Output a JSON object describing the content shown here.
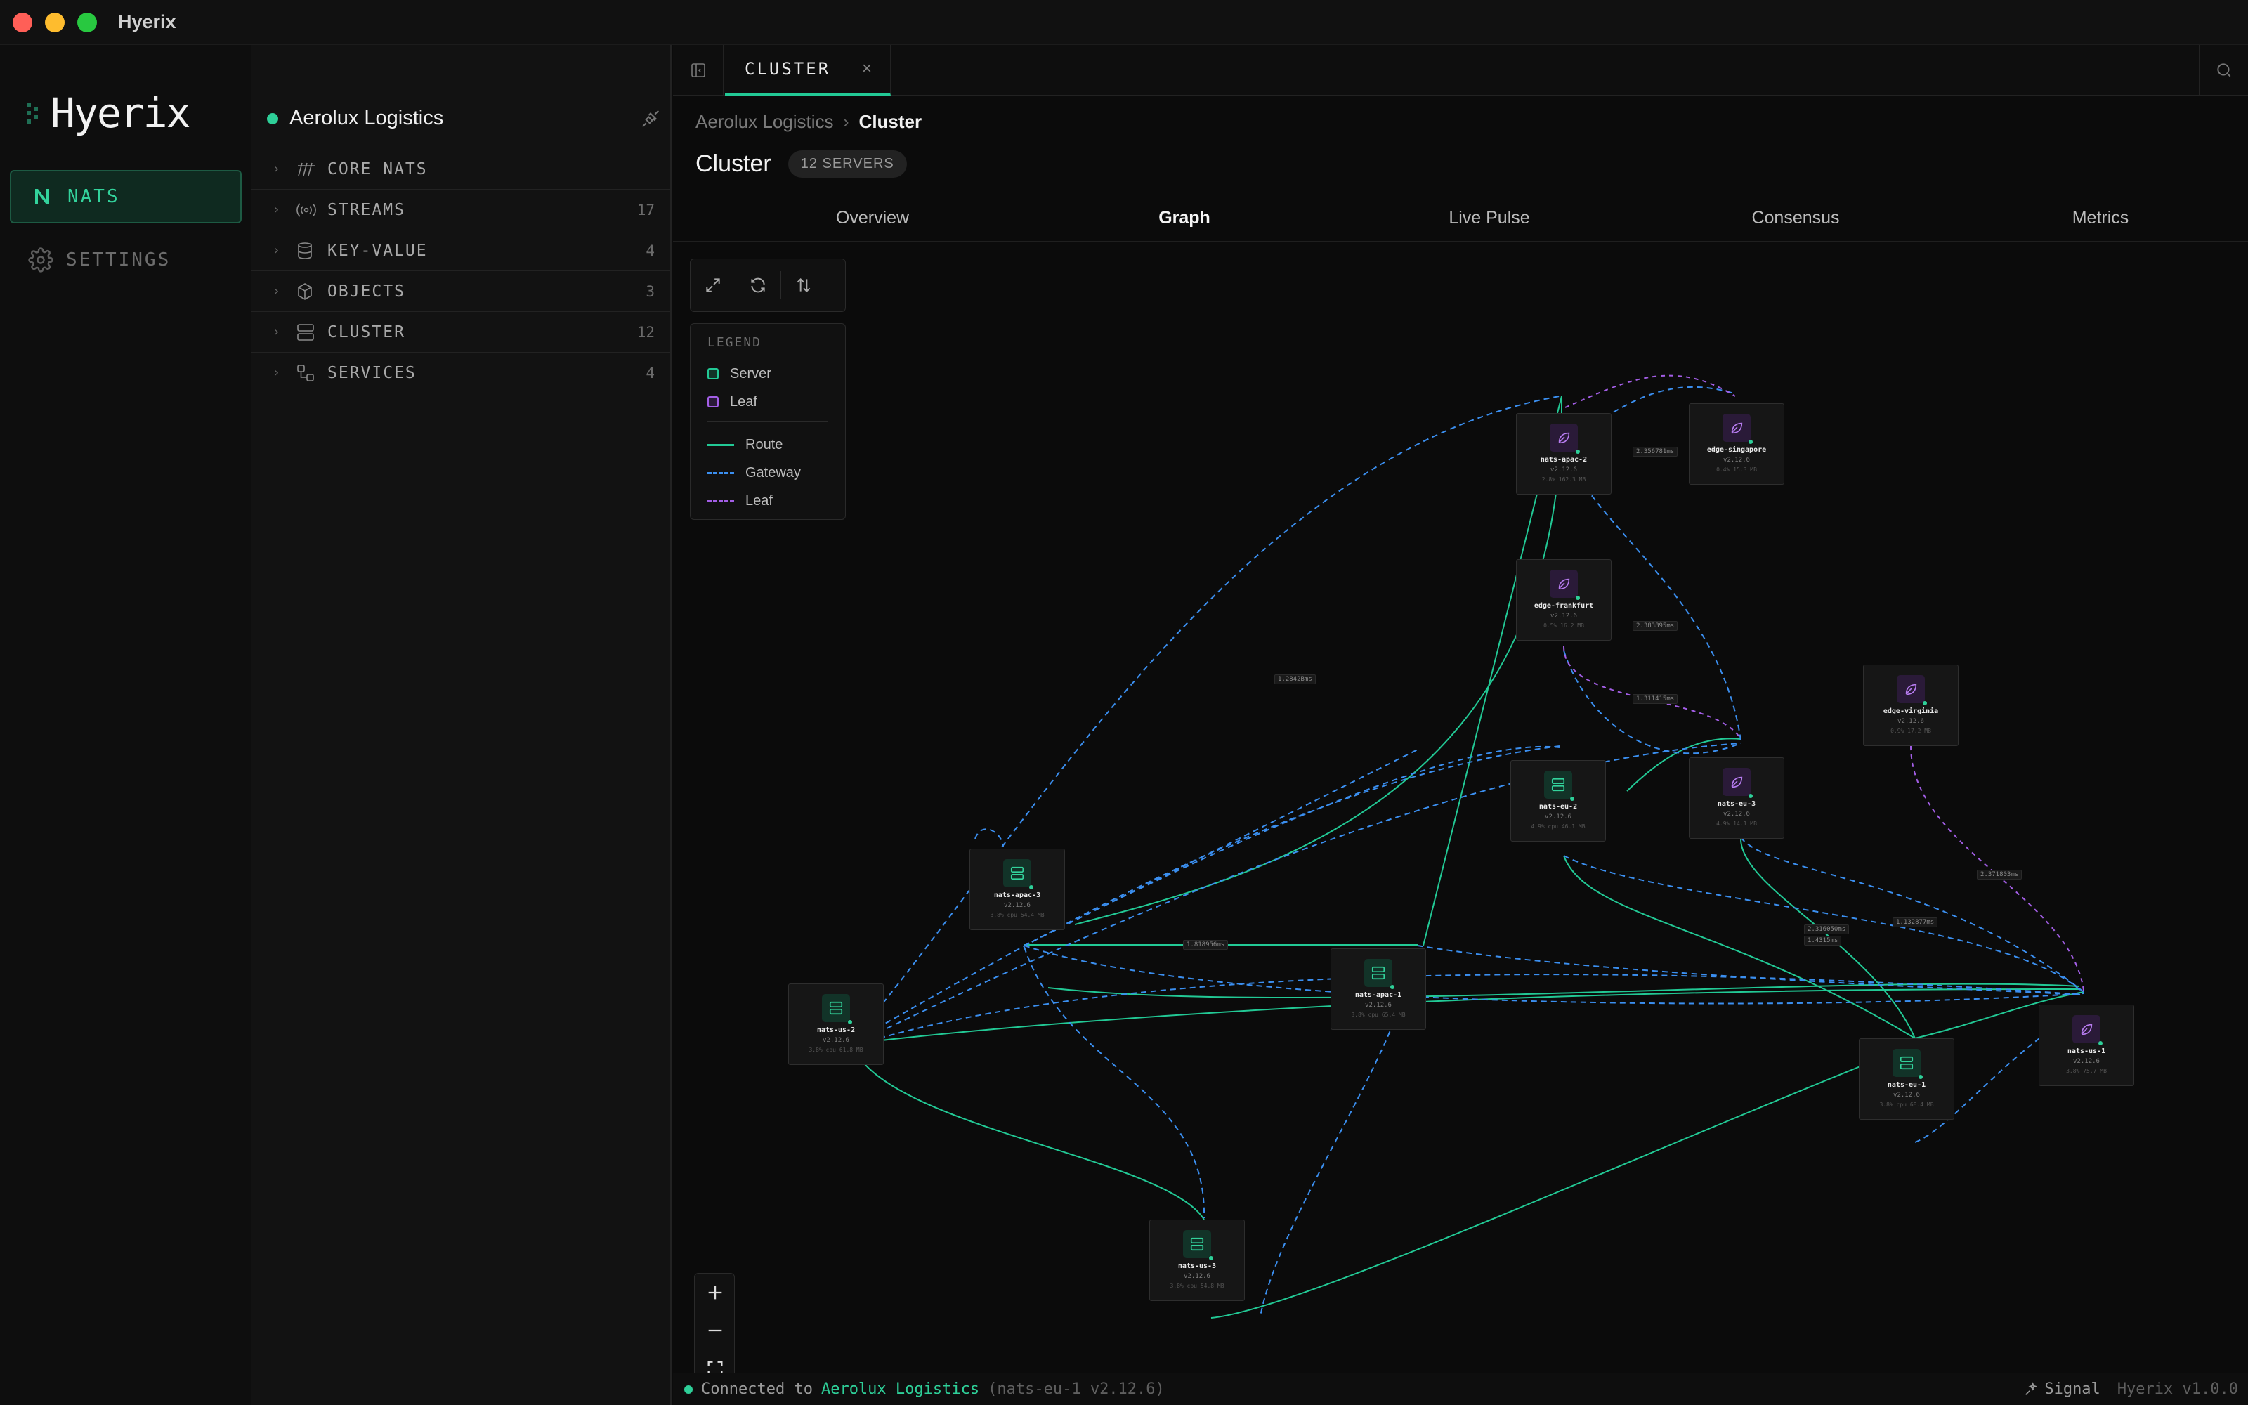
{
  "window": {
    "title": "Hyerix"
  },
  "rail": {
    "brand": "Hyerix",
    "items": [
      {
        "label": "NATS",
        "icon": "nats-n-icon",
        "active": true
      },
      {
        "label": "SETTINGS",
        "icon": "gear-icon",
        "active": false
      }
    ]
  },
  "explorer": {
    "connection": {
      "name": "Aerolux Logistics",
      "status_color": "#2ecf98"
    },
    "tree": [
      {
        "label": "CORE NATS",
        "icon": "core-nats-icon",
        "count": ""
      },
      {
        "label": "STREAMS",
        "icon": "broadcast-icon",
        "count": "17"
      },
      {
        "label": "KEY-VALUE",
        "icon": "database-icon",
        "count": "4"
      },
      {
        "label": "OBJECTS",
        "icon": "cube-icon",
        "count": "3"
      },
      {
        "label": "CLUSTER",
        "icon": "server-icon",
        "count": "12"
      },
      {
        "label": "SERVICES",
        "icon": "services-icon",
        "count": "4"
      }
    ]
  },
  "tab": {
    "label": "CLUSTER",
    "close": "×"
  },
  "breadcrumb": {
    "parent": "Aerolux Logistics",
    "separator": "›",
    "current": "Cluster"
  },
  "page": {
    "title": "Cluster",
    "badge": "12 SERVERS"
  },
  "subtabs": [
    "Overview",
    "Graph",
    "Live Pulse",
    "Consensus",
    "Metrics"
  ],
  "active_subtab": "Graph",
  "legend": {
    "title": "LEGEND",
    "nodes": [
      {
        "label": "Server",
        "color": "#22c995"
      },
      {
        "label": "Leaf",
        "color": "#a35ee6"
      }
    ],
    "edges": [
      {
        "label": "Route",
        "color": "#22c995",
        "style": "solid"
      },
      {
        "label": "Gateway",
        "color": "#3b8ff0",
        "style": "dashed"
      },
      {
        "label": "Leaf",
        "color": "#a35ee6",
        "style": "dashed"
      }
    ]
  },
  "nodes": [
    {
      "name": "nats-apac-2",
      "kind": "leaf",
      "version": "v2.12.6",
      "stats": "2.8% 162.3 MB"
    },
    {
      "name": "edge-singapore",
      "kind": "leaf",
      "version": "v2.12.6",
      "stats": "0.4% 15.3 MB"
    },
    {
      "name": "edge-frankfurt",
      "kind": "leaf",
      "version": "v2.12.6",
      "stats": "0.5% 16.2 MB"
    },
    {
      "name": "edge-virginia",
      "kind": "leaf",
      "version": "v2.12.6",
      "stats": "0.9% 17.2 MB"
    },
    {
      "name": "nats-eu-2",
      "kind": "server",
      "version": "v2.12.6",
      "stats": "4.9% cpu 46.1 MB"
    },
    {
      "name": "nats-eu-3",
      "kind": "leaf",
      "version": "v2.12.6",
      "stats": "4.9% 14.1 MB"
    },
    {
      "name": "nats-apac-3",
      "kind": "server",
      "version": "v2.12.6",
      "stats": "3.8% cpu 54.4 MB"
    },
    {
      "name": "nats-apac-1",
      "kind": "server",
      "version": "v2.12.6",
      "stats": "3.8% cpu 65.4 MB"
    },
    {
      "name": "nats-us-2",
      "kind": "server",
      "version": "v2.12.6",
      "stats": "3.8% cpu 61.8 MB"
    },
    {
      "name": "nats-eu-1",
      "kind": "server",
      "version": "v2.12.6",
      "stats": "3.8% cpu 68.4 MB"
    },
    {
      "name": "nats-us-1",
      "kind": "leaf",
      "version": "v2.12.6",
      "stats": "3.8% 75.7 MB"
    },
    {
      "name": "nats-us-3",
      "kind": "server",
      "version": "v2.12.6",
      "stats": "3.8% cpu 54.8 MB"
    }
  ],
  "edge_labels": [
    "2.356781ms",
    "1.2842Bms",
    "2.383895ms",
    "1.311415ms",
    "1.818956ms",
    "2.316050ms",
    "1.4315ms",
    "1.132877ms",
    "2.371803ms"
  ],
  "zoom": {
    "in": "+",
    "out": "−"
  },
  "statusbar": {
    "prefix": "Connected to",
    "name": "Aerolux Logistics",
    "detail": "(nats-eu-1 v2.12.6)",
    "signal": "Signal",
    "app_version": "Hyerix v1.0.0"
  },
  "colors": {
    "accent": "#22c995",
    "gateway": "#3b8ff0",
    "leaf": "#a35ee6"
  }
}
